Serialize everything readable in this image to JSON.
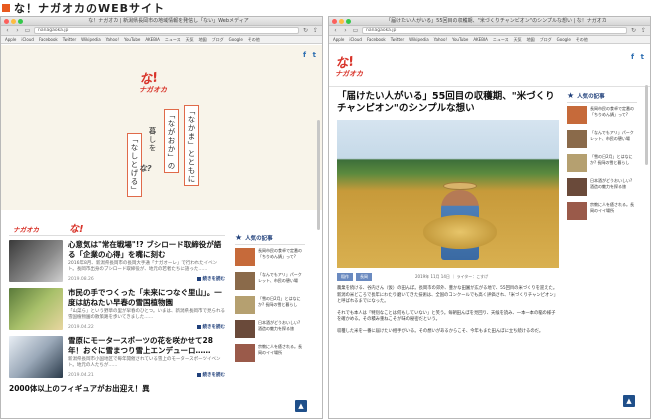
{
  "header": {
    "title": "な！ナガオカのWEBサイト",
    "accent": "#e8591e"
  },
  "browser": {
    "left_title": "な！ナガオカ | 新潟県長岡市の地域情報を発信し「ない」Webメディア",
    "right_title": "「届けたい人がいる」55回目の収穫期、\"米づくりチャンピオン\"のシンプルな想い | な！ナガオカ",
    "url": "nanagaoka.jp",
    "bookmarks": [
      "Apple",
      "iCloud",
      "Facebook",
      "Twitter",
      "Wikipedia",
      "Yahoo!",
      "YouTube",
      "AKEBIA",
      "ニュース",
      "天気",
      "地図",
      "ブログ",
      "Google",
      "その他"
    ]
  },
  "brand": {
    "logo_na": "な!",
    "logo_nagaoka": "ナガオカ",
    "logo_small": "な?"
  },
  "hero": {
    "v1": "「なかま」とともに",
    "v2": "「ながおか」の",
    "v3": "暮しを",
    "v4": "「なしとげる」"
  },
  "list": [
    {
      "title": "心意気は\"常在戦場\"!? ブシロード取締役が語る「企業の心得」を嘴に刻む",
      "desc": "2016年8月、新潟県長岡市の長岡大手通「ナガオーレ」で行われたイベント。長岡市出身のブシロード取締役が、地元の若者たちに語った……",
      "date": "2019.08.26",
      "more": "続きを読む"
    },
    {
      "title": "市民の手でつくった「未来につなぐ里山」。一度は訪ねたい早春の雪国植物園",
      "desc": "「山菜ら」という野草の里が早春のひとつ。いまは、新潟県長岡市で見られる雪国植物園の散策路を歩いてきました……",
      "date": "2019.04.22",
      "more": "続きを読む"
    },
    {
      "title": "雪原にモータースポーツの花を咲かせて28年！おぐに雪まつり雪上エンデューロ……",
      "desc": "新潟県長岡市小国地区で毎年開催されている雪上のモータースポーツイベント。地元の人たちが……",
      "date": "2019.04.21",
      "more": "続きを読む"
    },
    {
      "title": "2000体以上のフィギュアがお出迎え！異"
    }
  ],
  "popular": {
    "heading": "人気の記事",
    "items": [
      "長岡市民の食卓で定番の「ちりめん鍋」って?",
      "「なんでもアリ」パークレット、市民の憩い場",
      "「雪の日2月」とはなにか? 長岡の雪と暮らし",
      "日本酒がどうおいしい? 酒造の魅力を探る旅",
      "宗教に人を癒される。長岡のイイ場所"
    ]
  },
  "article": {
    "title": "「届けたい人がいる」55回目の収穫期、\"米づくりチャンピオン\"のシンプルな想い",
    "tags": [
      "稲作",
      "長岡"
    ],
    "date": "2019年 11月 14日 ｜ ライター：こすげ",
    "p1": "農業を続ける、谷内さん（仮）の田んぼ。長岡市の郊外、豊かな田園が広がる地で、55回目の米づくりを迎えた。新潟の米どころで長年にわたり磨いてきた技術は、全国のコンクールでも高く評価され、「米づくりチャンピオン」と呼ばれるまでになった。",
    "p2": "それでも本人は「特別なことは何もしていない」と笑う。毎朝田んぼを見回り、天候を読み、一本一本の稲の様子を確かめる。その積み重ねこそが味の秘密だという。",
    "p3": "収穫した米を一番に届けたい相手がいる。その想いがあるからこそ、今年もまた田んぼに立ち続けるのだ。"
  },
  "ui": {
    "totop": "▲",
    "facebook": "f",
    "twitter": "t"
  }
}
